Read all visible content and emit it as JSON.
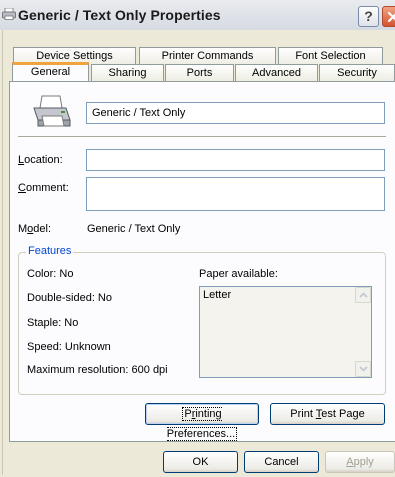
{
  "window": {
    "title": "Generic / Text Only Properties",
    "help_glyph": "?"
  },
  "tabs": {
    "row1": [
      {
        "label": "Device Settings"
      },
      {
        "label": "Printer Commands"
      },
      {
        "label": "Font Selection"
      }
    ],
    "row2": [
      {
        "label": "General",
        "active": true
      },
      {
        "label": "Sharing"
      },
      {
        "label": "Ports"
      },
      {
        "label": "Advanced"
      },
      {
        "label": "Security"
      }
    ]
  },
  "general": {
    "printer_name": "Generic / Text Only",
    "location_label_accel": "L",
    "location_label_rest": "ocation:",
    "location_value": "",
    "comment_label_accel": "C",
    "comment_label_rest": "omment:",
    "comment_value": "",
    "model_label_pre": "M",
    "model_label_accel": "o",
    "model_label_rest": "del:",
    "model_value": "Generic / Text Only"
  },
  "features": {
    "title": "Features",
    "color": "Color: No",
    "double_sided": "Double-sided: No",
    "staple": "Staple: No",
    "speed": "Speed: Unknown",
    "max_resolution": "Maximum resolution: 600 dpi",
    "paper_available_label": "Paper available:",
    "paper_available": [
      "Letter"
    ]
  },
  "panel_buttons": {
    "printing_preferences_pre": "P",
    "printing_preferences_accel": "r",
    "printing_preferences_rest": "inting Preferences...",
    "print_test_page_pre": "Print ",
    "print_test_page_accel": "T",
    "print_test_page_rest": "est Page"
  },
  "dialog_buttons": {
    "ok": "OK",
    "cancel": "Cancel",
    "apply_accel": "A",
    "apply_rest": "pply"
  },
  "colors": {
    "dialog_bg": "#ece9d8",
    "tab_page_bg": "#fcfcfe",
    "active_tab_accent": "#f3a33b",
    "group_title": "#0046d5",
    "input_border": "#7f9db9",
    "close_button": "#d6532e"
  },
  "icons": {
    "title": "printer-icon",
    "help": "help-icon",
    "close": "close-icon",
    "printer": "printer-icon",
    "scroll_up": "scroll-up-arrow-icon",
    "scroll_down": "scroll-down-arrow-icon"
  }
}
